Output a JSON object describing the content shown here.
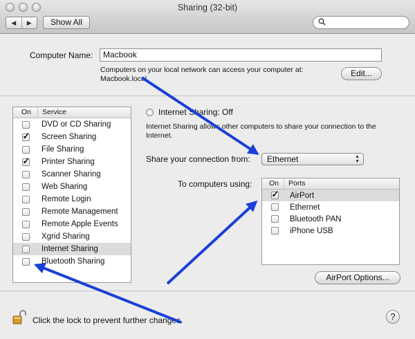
{
  "window": {
    "title": "Sharing (32-bit)"
  },
  "toolbar": {
    "back_glyph": "◀",
    "forward_glyph": "▶",
    "show_all_label": "Show All",
    "search_placeholder": ""
  },
  "computer_name": {
    "label": "Computer Name:",
    "value": "Macbook",
    "info_line1": "Computers on your local network can access your computer at:",
    "info_line2": "Macbook.local",
    "edit_label": "Edit..."
  },
  "services": {
    "header_on": "On",
    "header_service": "Service",
    "items": [
      {
        "label": "DVD or CD Sharing",
        "checked": false,
        "selected": false
      },
      {
        "label": "Screen Sharing",
        "checked": true,
        "selected": false
      },
      {
        "label": "File Sharing",
        "checked": false,
        "selected": false
      },
      {
        "label": "Printer Sharing",
        "checked": true,
        "selected": false
      },
      {
        "label": "Scanner Sharing",
        "checked": false,
        "selected": false
      },
      {
        "label": "Web Sharing",
        "checked": false,
        "selected": false
      },
      {
        "label": "Remote Login",
        "checked": false,
        "selected": false
      },
      {
        "label": "Remote Management",
        "checked": false,
        "selected": false
      },
      {
        "label": "Remote Apple Events",
        "checked": false,
        "selected": false
      },
      {
        "label": "Xgrid Sharing",
        "checked": false,
        "selected": false
      },
      {
        "label": "Internet Sharing",
        "checked": false,
        "selected": true
      },
      {
        "label": "Bluetooth Sharing",
        "checked": false,
        "selected": false
      }
    ]
  },
  "internet_sharing": {
    "status": "Internet Sharing: Off",
    "description": "Internet Sharing allows other computers to share your connection to the Internet.",
    "share_from_label": "Share your connection from:",
    "share_from_value": "Ethernet",
    "to_computers_label": "To computers using:",
    "ports_header_on": "On",
    "ports_header_ports": "Ports",
    "ports": [
      {
        "label": "AirPort",
        "checked": true,
        "selected": true
      },
      {
        "label": "Ethernet",
        "checked": false,
        "selected": false
      },
      {
        "label": "Bluetooth PAN",
        "checked": false,
        "selected": false
      },
      {
        "label": "iPhone USB",
        "checked": false,
        "selected": false
      }
    ],
    "airport_options_label": "AirPort Options..."
  },
  "footer": {
    "lock_text": "Click the lock to prevent further changes.",
    "help_glyph": "?"
  },
  "colors": {
    "annotation_arrow": "#1a3fd6",
    "selection": "#dcdcdc",
    "window_bg": "#ececec"
  },
  "icons": {
    "lock": "lock-open-icon",
    "search": "magnifier-icon",
    "help": "question-icon"
  }
}
